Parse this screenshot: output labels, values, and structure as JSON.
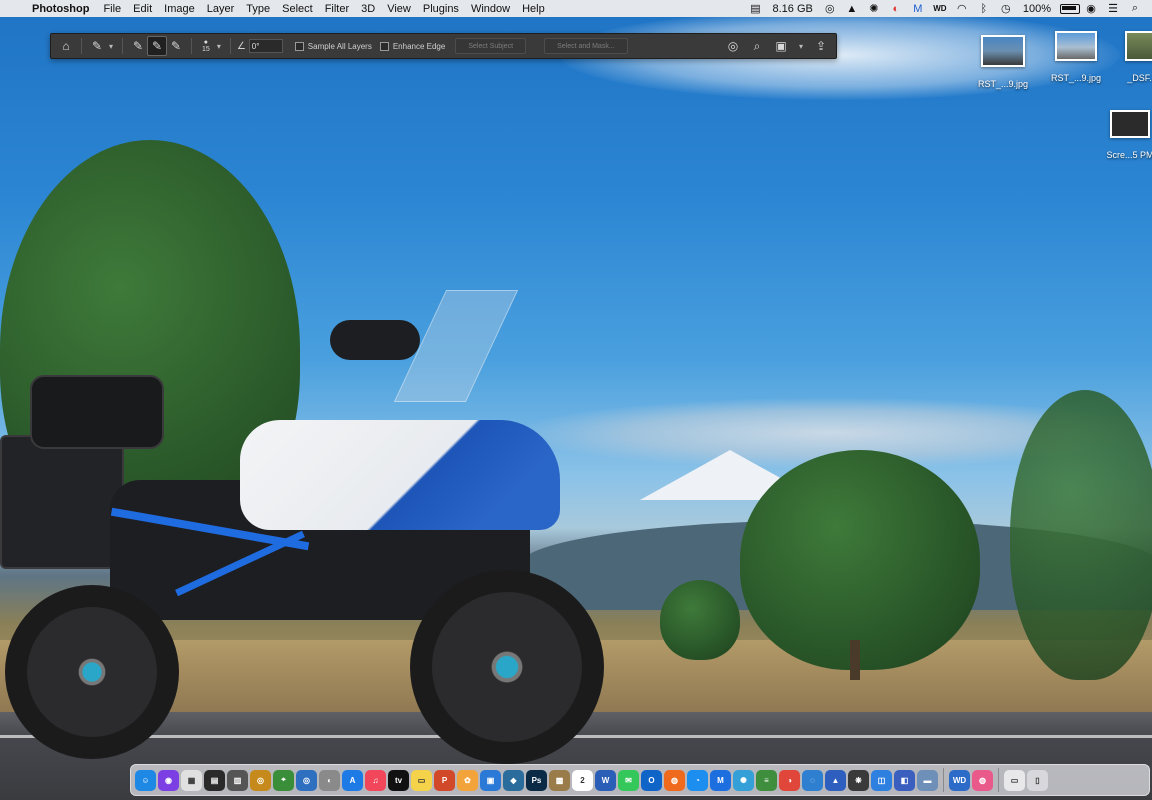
{
  "menubar": {
    "app_name": "Photoshop",
    "menus": [
      "File",
      "Edit",
      "Image",
      "Layer",
      "Type",
      "Select",
      "Filter",
      "3D",
      "View",
      "Plugins",
      "Window",
      "Help"
    ],
    "memory": "8.16 GB",
    "battery_percent": "100%"
  },
  "options_bar": {
    "brush_size": "15",
    "angle_value": "0°",
    "sample_all_layers_label": "Sample All Layers",
    "enhance_edge_label": "Enhance Edge",
    "select_subject_label": "Select Subject",
    "select_and_mask_label": "Select and Mask..."
  },
  "desktop_icons": [
    {
      "label": "RST_...9.jpg"
    },
    {
      "label": "RST_...9.jpg"
    },
    {
      "label": "_DSF..."
    },
    {
      "label": "Scre...5 PM"
    }
  ],
  "dock": {
    "apps": [
      {
        "name": "Finder",
        "glyph": "☺",
        "color": "#1e88e5"
      },
      {
        "name": "Siri",
        "glyph": "◉",
        "color": "#7b3fe4"
      },
      {
        "name": "Launchpad",
        "glyph": "▦",
        "color": "#e0e0e0"
      },
      {
        "name": "Activity",
        "glyph": "▤",
        "color": "#2a2a2a"
      },
      {
        "name": "Calculator",
        "glyph": "▥",
        "color": "#555"
      },
      {
        "name": "Compass",
        "glyph": "◎",
        "color": "#c58a1b"
      },
      {
        "name": "Maps",
        "glyph": "⌖",
        "color": "#3a8e3a"
      },
      {
        "name": "Lens",
        "glyph": "◎",
        "color": "#2f6fbf"
      },
      {
        "name": "Preview",
        "glyph": "◐",
        "color": "#8a8a8a"
      },
      {
        "name": "App Store",
        "glyph": "A",
        "color": "#1e7be6"
      },
      {
        "name": "Music",
        "glyph": "♫",
        "color": "#f2465b"
      },
      {
        "name": "TV",
        "glyph": "tv",
        "color": "#111"
      },
      {
        "name": "Notes",
        "glyph": "▭",
        "color": "#f4d34a"
      },
      {
        "name": "PowerPoint",
        "glyph": "P",
        "color": "#d2492a"
      },
      {
        "name": "Photos",
        "glyph": "✿",
        "color": "#f2a33a"
      },
      {
        "name": "Keynote",
        "glyph": "▣",
        "color": "#2b79d6"
      },
      {
        "name": "Cube",
        "glyph": "◆",
        "color": "#2a6d9d"
      },
      {
        "name": "Photoshop",
        "glyph": "Ps",
        "color": "#0a2a46"
      },
      {
        "name": "Archive",
        "glyph": "▩",
        "color": "#9a7b4a"
      },
      {
        "name": "Calendar",
        "glyph": "2",
        "color": "#fff"
      },
      {
        "name": "Word",
        "glyph": "W",
        "color": "#2b5eb7"
      },
      {
        "name": "Messages",
        "glyph": "✉",
        "color": "#34c759"
      },
      {
        "name": "Outlook",
        "glyph": "O",
        "color": "#0f64c8"
      },
      {
        "name": "Firefox",
        "glyph": "◍",
        "color": "#f06a1d"
      },
      {
        "name": "Safari",
        "glyph": "◔",
        "color": "#1c8ef0"
      },
      {
        "name": "Malwarebytes",
        "glyph": "M",
        "color": "#1d6fe0"
      },
      {
        "name": "Spark",
        "glyph": "✺",
        "color": "#35a0d8"
      },
      {
        "name": "Memory",
        "glyph": "≡",
        "color": "#3e8e3e"
      },
      {
        "name": "Chrome",
        "glyph": "◑",
        "color": "#e0463a"
      },
      {
        "name": "Globe",
        "glyph": "◌",
        "color": "#2f7fd0"
      },
      {
        "name": "Remote",
        "glyph": "▲",
        "color": "#2e5fbf"
      },
      {
        "name": "Flower",
        "glyph": "❋",
        "color": "#3a3a3a"
      },
      {
        "name": "Screen",
        "glyph": "◫",
        "color": "#2d7fe0"
      },
      {
        "name": "Profiles",
        "glyph": "◧",
        "color": "#3a5fbf"
      },
      {
        "name": "Finder Window",
        "glyph": "▬",
        "color": "#6d8fb8"
      },
      {
        "name": "WD",
        "glyph": "WD",
        "color": "#2c6bc7"
      },
      {
        "name": "Creative",
        "glyph": "◍",
        "color": "#e95a8a"
      },
      {
        "name": "Downloads",
        "glyph": "▭",
        "color": "#e8e8ea"
      },
      {
        "name": "Trash",
        "glyph": "▯",
        "color": "#d8d8dc"
      }
    ]
  }
}
